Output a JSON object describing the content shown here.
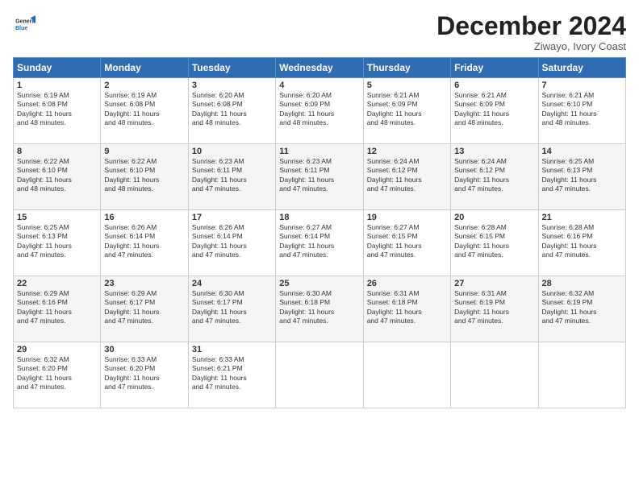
{
  "header": {
    "logo_line1": "General",
    "logo_line2": "Blue",
    "title": "December 2024",
    "location": "Ziwayo, Ivory Coast"
  },
  "days_of_week": [
    "Sunday",
    "Monday",
    "Tuesday",
    "Wednesday",
    "Thursday",
    "Friday",
    "Saturday"
  ],
  "weeks": [
    [
      {
        "day": 1,
        "info": "Sunrise: 6:19 AM\nSunset: 6:08 PM\nDaylight: 11 hours\nand 48 minutes."
      },
      {
        "day": 2,
        "info": "Sunrise: 6:19 AM\nSunset: 6:08 PM\nDaylight: 11 hours\nand 48 minutes."
      },
      {
        "day": 3,
        "info": "Sunrise: 6:20 AM\nSunset: 6:08 PM\nDaylight: 11 hours\nand 48 minutes."
      },
      {
        "day": 4,
        "info": "Sunrise: 6:20 AM\nSunset: 6:09 PM\nDaylight: 11 hours\nand 48 minutes."
      },
      {
        "day": 5,
        "info": "Sunrise: 6:21 AM\nSunset: 6:09 PM\nDaylight: 11 hours\nand 48 minutes."
      },
      {
        "day": 6,
        "info": "Sunrise: 6:21 AM\nSunset: 6:09 PM\nDaylight: 11 hours\nand 48 minutes."
      },
      {
        "day": 7,
        "info": "Sunrise: 6:21 AM\nSunset: 6:10 PM\nDaylight: 11 hours\nand 48 minutes."
      }
    ],
    [
      {
        "day": 8,
        "info": "Sunrise: 6:22 AM\nSunset: 6:10 PM\nDaylight: 11 hours\nand 48 minutes."
      },
      {
        "day": 9,
        "info": "Sunrise: 6:22 AM\nSunset: 6:10 PM\nDaylight: 11 hours\nand 48 minutes."
      },
      {
        "day": 10,
        "info": "Sunrise: 6:23 AM\nSunset: 6:11 PM\nDaylight: 11 hours\nand 47 minutes."
      },
      {
        "day": 11,
        "info": "Sunrise: 6:23 AM\nSunset: 6:11 PM\nDaylight: 11 hours\nand 47 minutes."
      },
      {
        "day": 12,
        "info": "Sunrise: 6:24 AM\nSunset: 6:12 PM\nDaylight: 11 hours\nand 47 minutes."
      },
      {
        "day": 13,
        "info": "Sunrise: 6:24 AM\nSunset: 6:12 PM\nDaylight: 11 hours\nand 47 minutes."
      },
      {
        "day": 14,
        "info": "Sunrise: 6:25 AM\nSunset: 6:13 PM\nDaylight: 11 hours\nand 47 minutes."
      }
    ],
    [
      {
        "day": 15,
        "info": "Sunrise: 6:25 AM\nSunset: 6:13 PM\nDaylight: 11 hours\nand 47 minutes."
      },
      {
        "day": 16,
        "info": "Sunrise: 6:26 AM\nSunset: 6:14 PM\nDaylight: 11 hours\nand 47 minutes."
      },
      {
        "day": 17,
        "info": "Sunrise: 6:26 AM\nSunset: 6:14 PM\nDaylight: 11 hours\nand 47 minutes."
      },
      {
        "day": 18,
        "info": "Sunrise: 6:27 AM\nSunset: 6:14 PM\nDaylight: 11 hours\nand 47 minutes."
      },
      {
        "day": 19,
        "info": "Sunrise: 6:27 AM\nSunset: 6:15 PM\nDaylight: 11 hours\nand 47 minutes."
      },
      {
        "day": 20,
        "info": "Sunrise: 6:28 AM\nSunset: 6:15 PM\nDaylight: 11 hours\nand 47 minutes."
      },
      {
        "day": 21,
        "info": "Sunrise: 6:28 AM\nSunset: 6:16 PM\nDaylight: 11 hours\nand 47 minutes."
      }
    ],
    [
      {
        "day": 22,
        "info": "Sunrise: 6:29 AM\nSunset: 6:16 PM\nDaylight: 11 hours\nand 47 minutes."
      },
      {
        "day": 23,
        "info": "Sunrise: 6:29 AM\nSunset: 6:17 PM\nDaylight: 11 hours\nand 47 minutes."
      },
      {
        "day": 24,
        "info": "Sunrise: 6:30 AM\nSunset: 6:17 PM\nDaylight: 11 hours\nand 47 minutes."
      },
      {
        "day": 25,
        "info": "Sunrise: 6:30 AM\nSunset: 6:18 PM\nDaylight: 11 hours\nand 47 minutes."
      },
      {
        "day": 26,
        "info": "Sunrise: 6:31 AM\nSunset: 6:18 PM\nDaylight: 11 hours\nand 47 minutes."
      },
      {
        "day": 27,
        "info": "Sunrise: 6:31 AM\nSunset: 6:19 PM\nDaylight: 11 hours\nand 47 minutes."
      },
      {
        "day": 28,
        "info": "Sunrise: 6:32 AM\nSunset: 6:19 PM\nDaylight: 11 hours\nand 47 minutes."
      }
    ],
    [
      {
        "day": 29,
        "info": "Sunrise: 6:32 AM\nSunset: 6:20 PM\nDaylight: 11 hours\nand 47 minutes."
      },
      {
        "day": 30,
        "info": "Sunrise: 6:33 AM\nSunset: 6:20 PM\nDaylight: 11 hours\nand 47 minutes."
      },
      {
        "day": 31,
        "info": "Sunrise: 6:33 AM\nSunset: 6:21 PM\nDaylight: 11 hours\nand 47 minutes."
      },
      null,
      null,
      null,
      null
    ]
  ]
}
